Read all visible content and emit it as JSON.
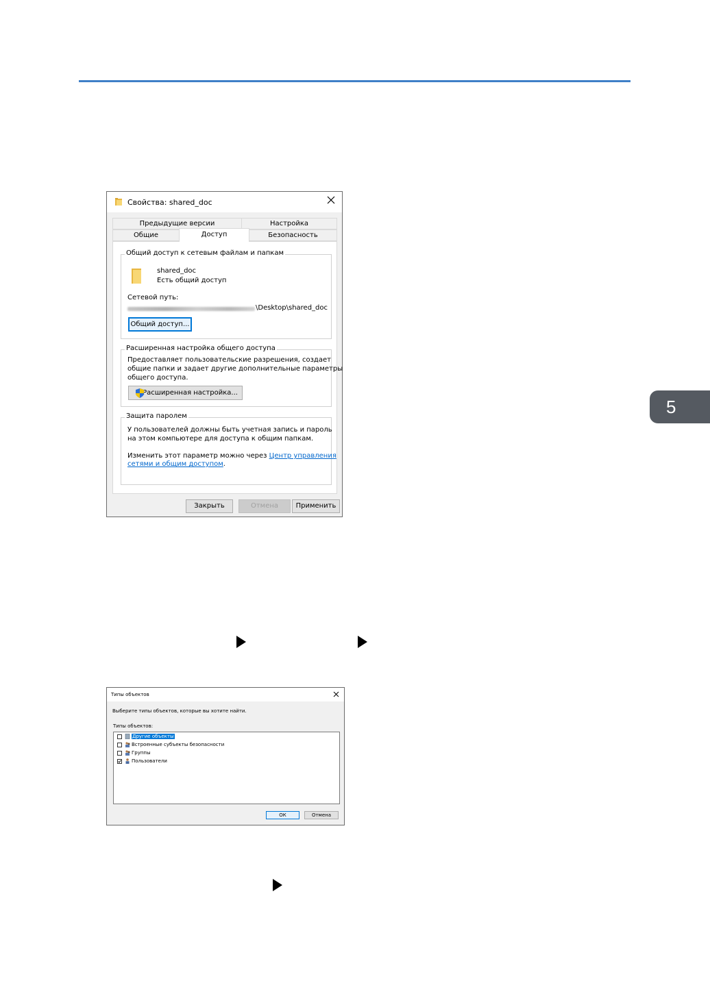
{
  "page": {
    "chapter_number": "5",
    "colors": {
      "rule": "#3f7fc7",
      "chapter_tab": "#555a61",
      "link": "#0066cc",
      "focus": "#0078d7"
    }
  },
  "dialog1": {
    "title": "Свойства: shared_doc",
    "close_icon": "close-icon",
    "tabs_row1": [
      "Предыдущие версии",
      "Настройка"
    ],
    "tabs_row2": [
      "Общие",
      "Доступ",
      "Безопасность"
    ],
    "active_tab": "Доступ",
    "network_group": {
      "title": "Общий доступ к сетевым файлам и папкам",
      "folder_name": "shared_doc",
      "folder_status": "Есть общий доступ",
      "path_label": "Сетевой путь:",
      "path_value": "\\Desktop\\shared_doc",
      "share_button": "Общий доступ..."
    },
    "advanced_group": {
      "title": "Расширенная настройка общего доступа",
      "line1": "Предоставляет пользовательские разрешения, создает",
      "line2": "общие папки и задает другие дополнительные параметры",
      "line3": "общего доступа.",
      "button": "Расширенная настройка..."
    },
    "password_group": {
      "title": "Защита паролем",
      "line1": "У пользователей должны быть учетная запись и пароль",
      "line2": "на этом компьютере для доступа к общим папкам.",
      "change_text": "Изменить этот параметр можно через ",
      "link1": "Центр управления",
      "link2": "сетями и общим доступом",
      "period": "."
    },
    "buttons": {
      "close": "Закрыть",
      "cancel": "Отмена",
      "apply": "Применить"
    }
  },
  "dialog2": {
    "title": "Типы объектов",
    "instruction": "Выберите типы объектов, которые вы хотите найти.",
    "list_label": "Типы объектов:",
    "items": [
      {
        "label": "Другие объекты",
        "checked": false,
        "selected": true,
        "icon": "generic-object-icon"
      },
      {
        "label": "Встроенные субъекты безопасности",
        "checked": false,
        "selected": false,
        "icon": "group-users-icon"
      },
      {
        "label": "Группы",
        "checked": false,
        "selected": false,
        "icon": "group-users-icon"
      },
      {
        "label": "Пользователи",
        "checked": true,
        "selected": false,
        "icon": "user-icon"
      }
    ],
    "buttons": {
      "ok": "ОК",
      "cancel": "Отмена"
    }
  }
}
